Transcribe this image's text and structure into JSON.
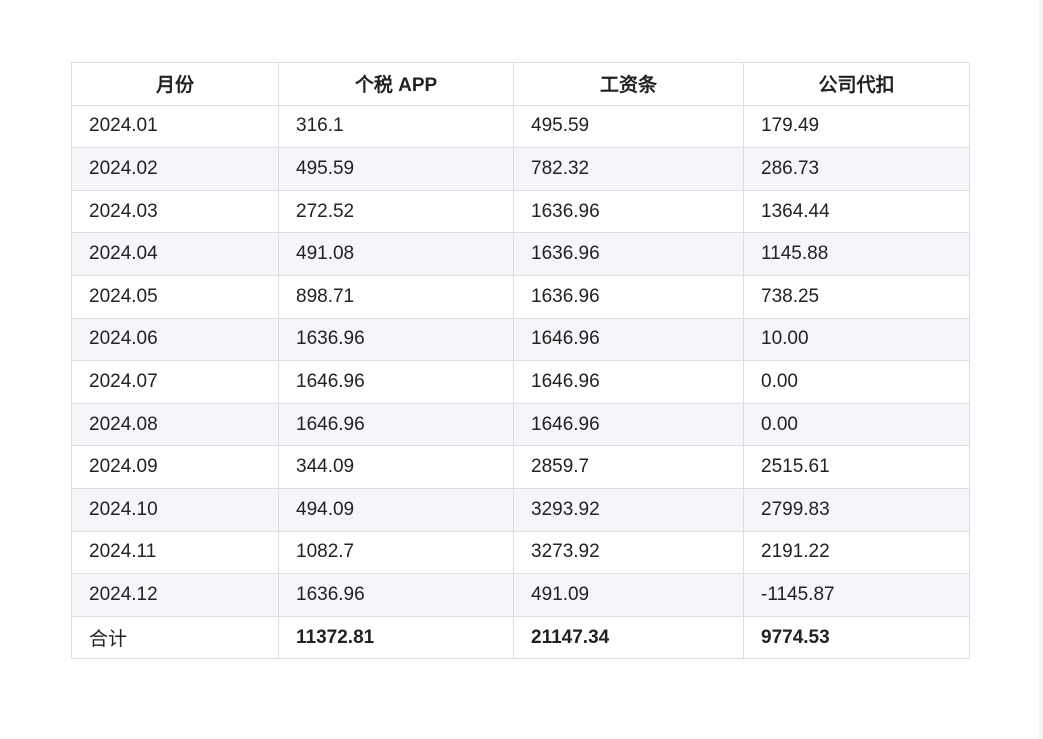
{
  "table": {
    "headers": [
      "月份",
      "个税 APP",
      "工资条",
      "公司代扣"
    ],
    "rows": [
      [
        "2024.01",
        "316.1",
        "495.59",
        "179.49"
      ],
      [
        "2024.02",
        "495.59",
        "782.32",
        "286.73"
      ],
      [
        "2024.03",
        "272.52",
        "1636.96",
        "1364.44"
      ],
      [
        "2024.04",
        "491.08",
        "1636.96",
        "1145.88"
      ],
      [
        "2024.05",
        "898.71",
        "1636.96",
        "738.25"
      ],
      [
        "2024.06",
        "1636.96",
        "1646.96",
        "10.00"
      ],
      [
        "2024.07",
        "1646.96",
        "1646.96",
        "0.00"
      ],
      [
        "2024.08",
        "1646.96",
        "1646.96",
        "0.00"
      ],
      [
        "2024.09",
        "344.09",
        "2859.7",
        "2515.61"
      ],
      [
        "2024.10",
        "494.09",
        "3293.92",
        "2799.83"
      ],
      [
        "2024.11",
        "1082.7",
        "3273.92",
        "2191.22"
      ],
      [
        "2024.12",
        "1636.96",
        "491.09",
        "-1145.87"
      ]
    ],
    "total": [
      "合计",
      "11372.81",
      "21147.34",
      "9774.53"
    ]
  },
  "colors": {
    "border": "#dcdee2",
    "stripe": "#f5f6fa",
    "text": "#222222"
  }
}
